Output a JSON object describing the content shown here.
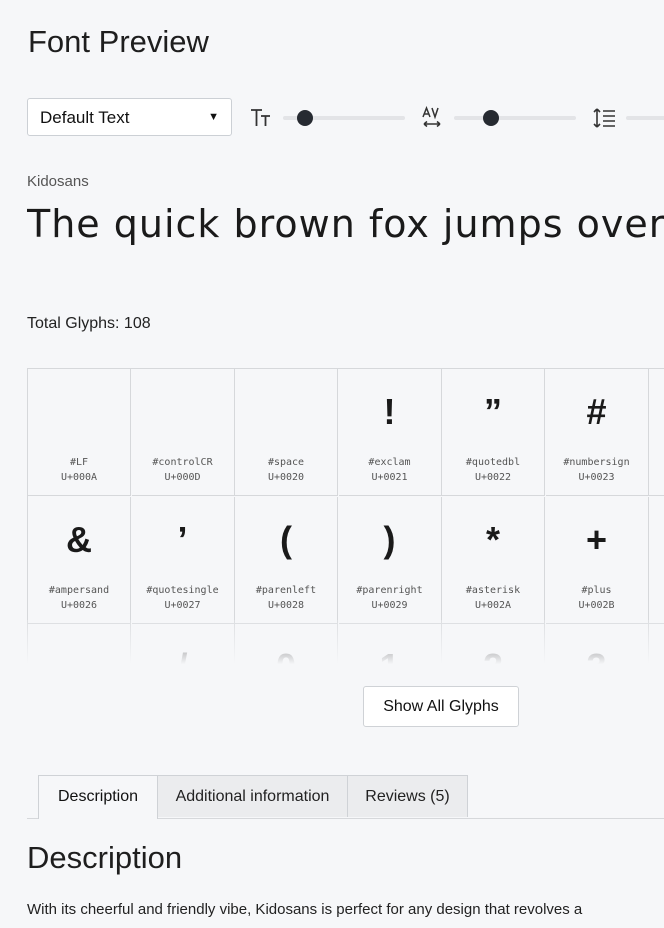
{
  "header": {
    "title": "Font Preview"
  },
  "controls": {
    "text_select": {
      "value": "Default Text"
    },
    "font_size": {
      "icon": "font-size-icon",
      "level": 0.18
    },
    "letter_spacing": {
      "icon": "letter-spacing-icon",
      "level": 0.3
    },
    "line_height": {
      "icon": "line-height-icon"
    }
  },
  "font": {
    "name": "Kidosans",
    "preview_text": "The quick brown fox jumps over the lazy dog"
  },
  "glyphs": {
    "total_label": "Total Glyphs: 108",
    "items": [
      {
        "glyph": "",
        "name": "#LF",
        "code": "U+000A"
      },
      {
        "glyph": "",
        "name": "#controlCR",
        "code": "U+000D"
      },
      {
        "glyph": "",
        "name": "#space",
        "code": "U+0020"
      },
      {
        "glyph": "!",
        "name": "#exclam",
        "code": "U+0021"
      },
      {
        "glyph": "”",
        "name": "#quotedbl",
        "code": "U+0022"
      },
      {
        "glyph": "#",
        "name": "#numbersign",
        "code": "U+0023"
      },
      {
        "glyph": "&",
        "name": "#ampersand",
        "code": "U+0026"
      },
      {
        "glyph": "’",
        "name": "#quotesingle",
        "code": "U+0027"
      },
      {
        "glyph": "(",
        "name": "#parenleft",
        "code": "U+0028"
      },
      {
        "glyph": ")",
        "name": "#parenright",
        "code": "U+0029"
      },
      {
        "glyph": "*",
        "name": "#asterisk",
        "code": "U+002A"
      },
      {
        "glyph": "+",
        "name": "#plus",
        "code": "U+002B"
      },
      {
        "glyph": "",
        "name": "",
        "code": ""
      },
      {
        "glyph": "/",
        "name": "",
        "code": ""
      },
      {
        "glyph": "0",
        "name": "",
        "code": ""
      },
      {
        "glyph": "1",
        "name": "",
        "code": ""
      },
      {
        "glyph": "2",
        "name": "",
        "code": ""
      },
      {
        "glyph": "3",
        "name": "",
        "code": ""
      }
    ],
    "show_all_label": "Show All Glyphs"
  },
  "tabs": [
    {
      "label": "Description",
      "active": true
    },
    {
      "label": "Additional information",
      "active": false
    },
    {
      "label": "Reviews (5)",
      "active": false
    }
  ],
  "description": {
    "title": "Description",
    "text": "With its cheerful and friendly vibe, Kidosans is perfect for any design that revolves a"
  }
}
